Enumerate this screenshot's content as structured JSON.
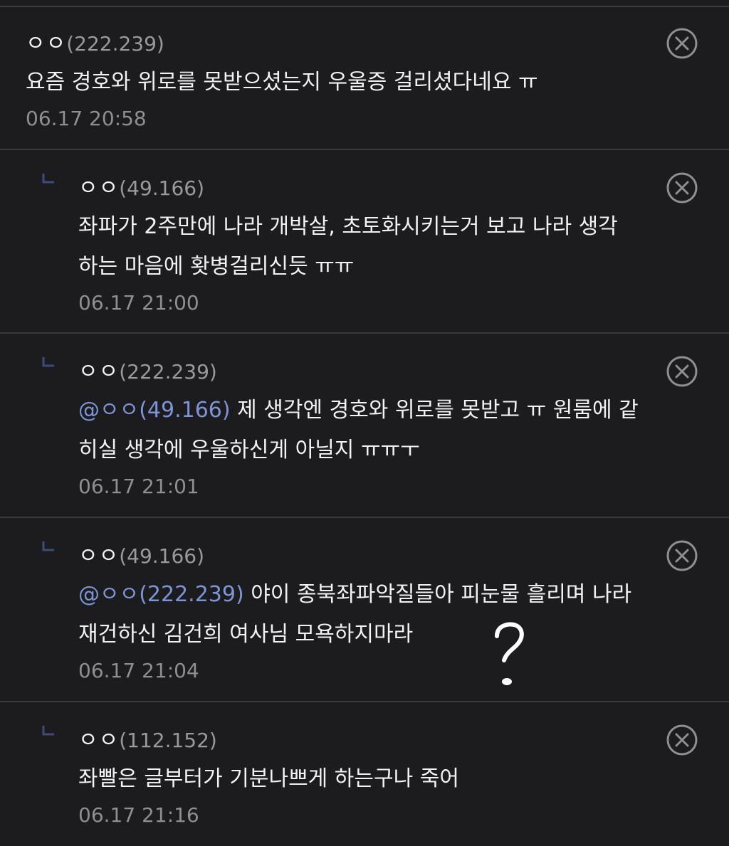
{
  "comments": [
    {
      "author_name": "ㅇㅇ",
      "author_ip": "(222.239)",
      "mention": "",
      "line1": "요즘 경호와 위로를 못받으셨는지 우울증 걸리셨다네요 ㅠ",
      "line2": "",
      "timestamp": "06.17 20:58",
      "is_reply": false,
      "delete_icon": "close-circle-icon"
    },
    {
      "author_name": "ㅇㅇ",
      "author_ip": "(49.166)",
      "mention": "",
      "line1": "좌파가 2주만에 나라 개박살, 초토화시키는거 보고 나라 생각",
      "line2": "하는 마음에 홧병걸리신듯 ㅠㅠ",
      "timestamp": "06.17 21:00",
      "is_reply": true,
      "delete_icon": "close-circle-icon"
    },
    {
      "author_name": "ㅇㅇ",
      "author_ip": "(222.239)",
      "mention": "@ㅇㅇ(49.166)",
      "line1": " 제 생각엔 경호와 위로를 못받고 ㅠ 원룸에 같",
      "line2": "히실 생각에 우울하신게 아닐지 ㅠㅠㅜ",
      "timestamp": "06.17 21:01",
      "is_reply": true,
      "delete_icon": "close-circle-icon"
    },
    {
      "author_name": "ㅇㅇ",
      "author_ip": "(49.166)",
      "mention": "@ㅇㅇ(222.239)",
      "line1": " 야이 종북좌파악질들아 피눈물 흘리며 나라",
      "line2": "재건하신 김건희 여사님 모욕하지마라",
      "timestamp": "06.17 21:04",
      "is_reply": true,
      "delete_icon": "close-circle-icon"
    },
    {
      "author_name": "ㅇㅇ",
      "author_ip": "(112.152)",
      "mention": "",
      "line1": "좌빨은 글부터가 기분나쁘게 하는구나 죽어",
      "line2": "",
      "timestamp": "06.17 21:16",
      "is_reply": true,
      "delete_icon": "close-circle-icon"
    }
  ],
  "colors": {
    "background": "#1c1c1e",
    "divider": "#3a3a3c",
    "text": "#f2f2f2",
    "ip": "#9a9a9a",
    "timestamp": "#8e8e93",
    "mention": "#7d95d6",
    "reply_icon": "#3d4a7a"
  },
  "annotation": {
    "icon": "question-mark-scribble-icon"
  }
}
